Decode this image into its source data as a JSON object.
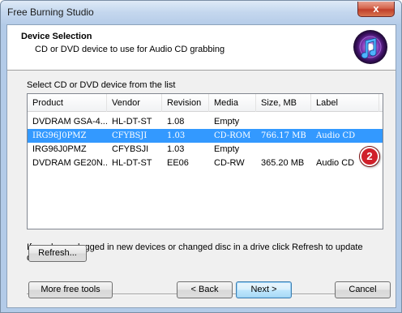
{
  "window": {
    "title": "Free Burning Studio",
    "close_label": "x"
  },
  "header": {
    "title": "Device Selection",
    "subtitle": "CD or DVD device to use for Audio CD grabbing",
    "logo_icon": "music-disc-icon"
  },
  "device_list": {
    "caption": "Select CD or DVD device from the list",
    "columns": [
      "Product",
      "Vendor",
      "Revision",
      "Media",
      "Size, MB",
      "Label"
    ],
    "rows": [
      {
        "product": "DVDRAM GSA-4...",
        "vendor": "HL-DT-ST",
        "revision": "1.08",
        "media": "Empty",
        "size": "",
        "label": ""
      },
      {
        "product": "IRG96J0PMZ",
        "vendor": "CFYBSJI",
        "revision": "1.03",
        "media": "CD-ROM",
        "size": "766.17 MB",
        "label": "Audio CD"
      },
      {
        "product": "IRG96J0PMZ",
        "vendor": "CFYBSJI",
        "revision": "1.03",
        "media": "Empty",
        "size": "",
        "label": ""
      },
      {
        "product": "DVDRAM GE20N...",
        "vendor": "HL-DT-ST",
        "revision": "EE06",
        "media": "CD-RW",
        "size": "365.20 MB",
        "label": "Audio CD"
      }
    ],
    "selected_row": 1,
    "step_badge": "2"
  },
  "info": {
    "text": "If you have plugged in new devices or changed disc in a drive click Refresh to update devices list"
  },
  "buttons": {
    "refresh": "Refresh...",
    "more_tools": "More free tools",
    "back": "< Back",
    "next": "Next >",
    "cancel": "Cancel"
  },
  "colors": {
    "selection": "#3399ff",
    "badge": "#d0202a"
  }
}
